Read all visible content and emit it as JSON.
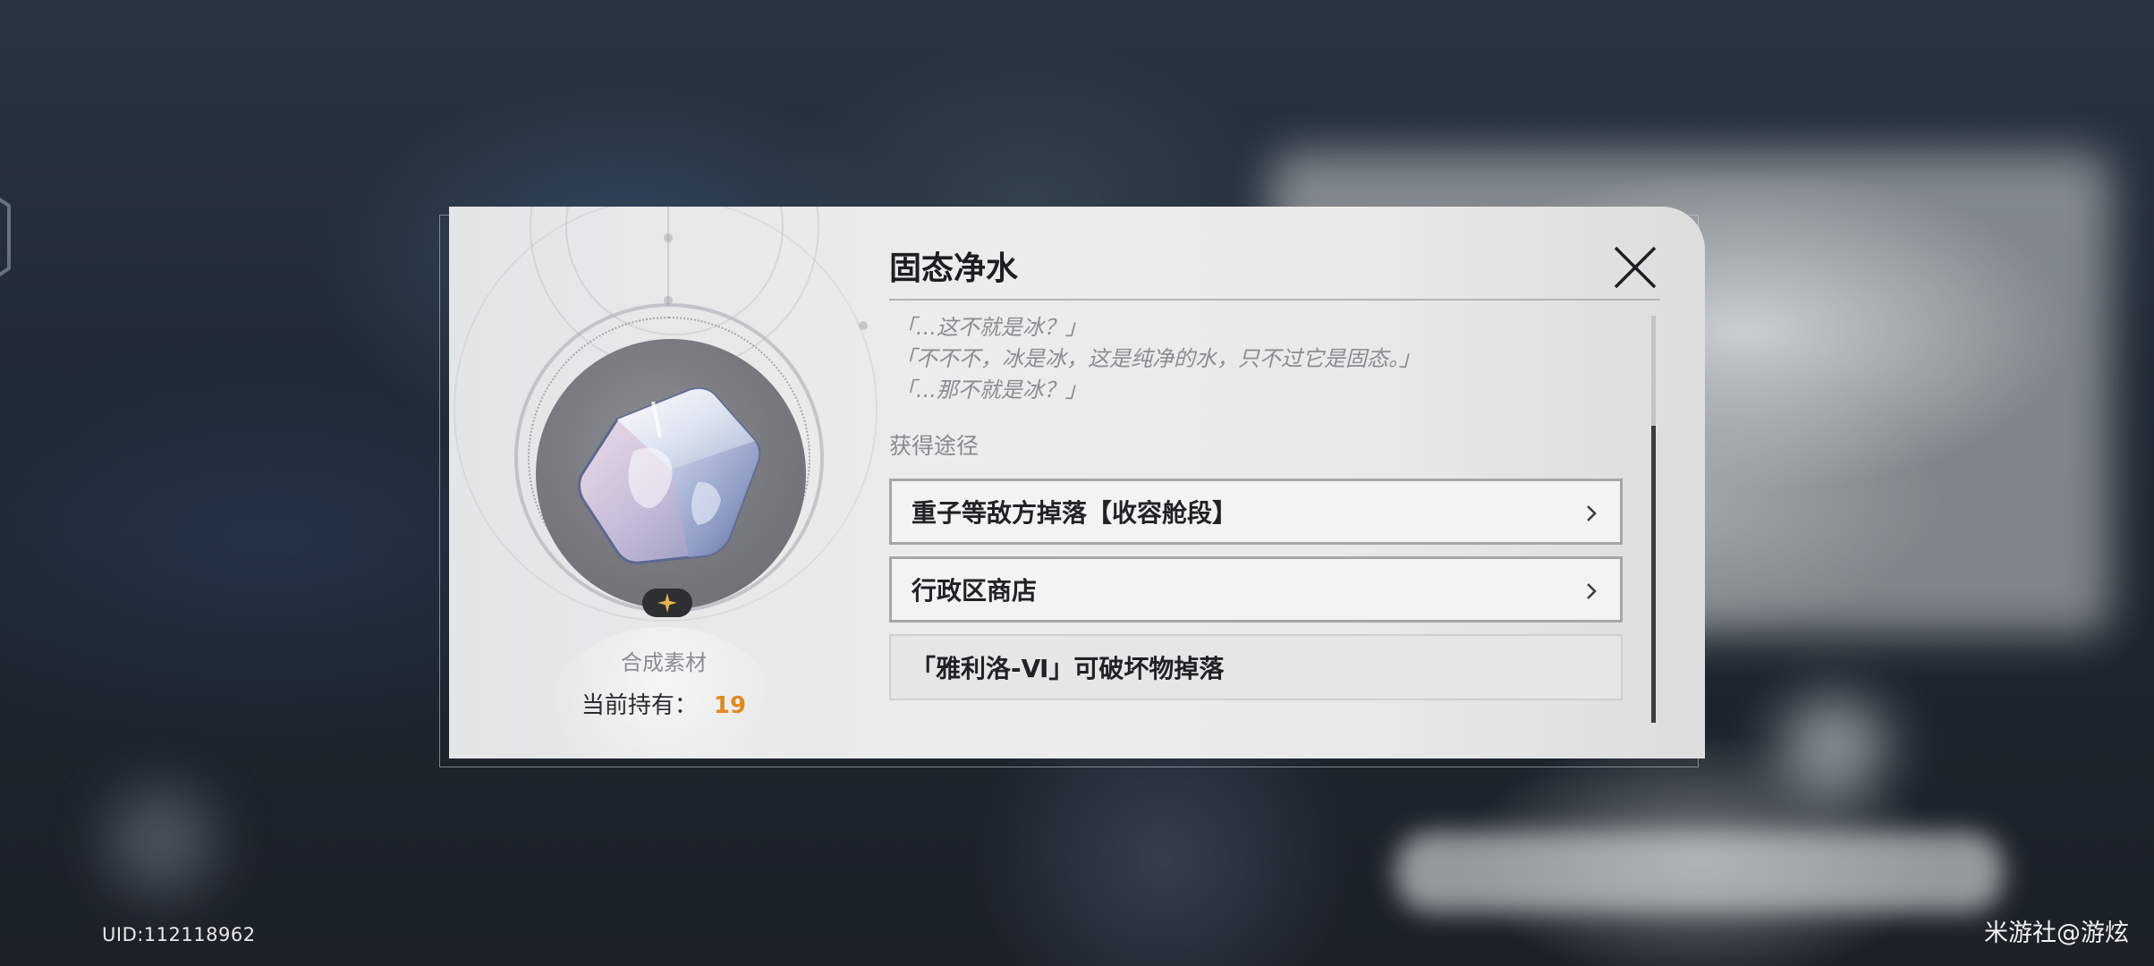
{
  "item": {
    "name": "固态净水",
    "category": "合成素材",
    "held_label": "当前持有：",
    "held_count": "19",
    "icon": "ice-cube-icon",
    "rarity_icon": "sparkle-star-icon"
  },
  "description": [
    "「...这不就是冰？」",
    "「不不不，冰是冰，这是纯净的水，只不过它是固态。」",
    "「...那不就是冰？」"
  ],
  "sources_label": "获得途径",
  "sources": [
    {
      "label": "重子等敌方掉落【收容舱段】",
      "navigable": true
    },
    {
      "label": "行政区商店",
      "navigable": true
    },
    {
      "label": "「雅利洛-Ⅵ」可破坏物掉落",
      "navigable": false
    }
  ],
  "footer": {
    "uid": "UID:112118962",
    "watermark": "米游社@游炫"
  },
  "colors": {
    "count_accent": "#e08a1e",
    "panel_bg": "#ececec",
    "title_text": "#1e1e22"
  }
}
